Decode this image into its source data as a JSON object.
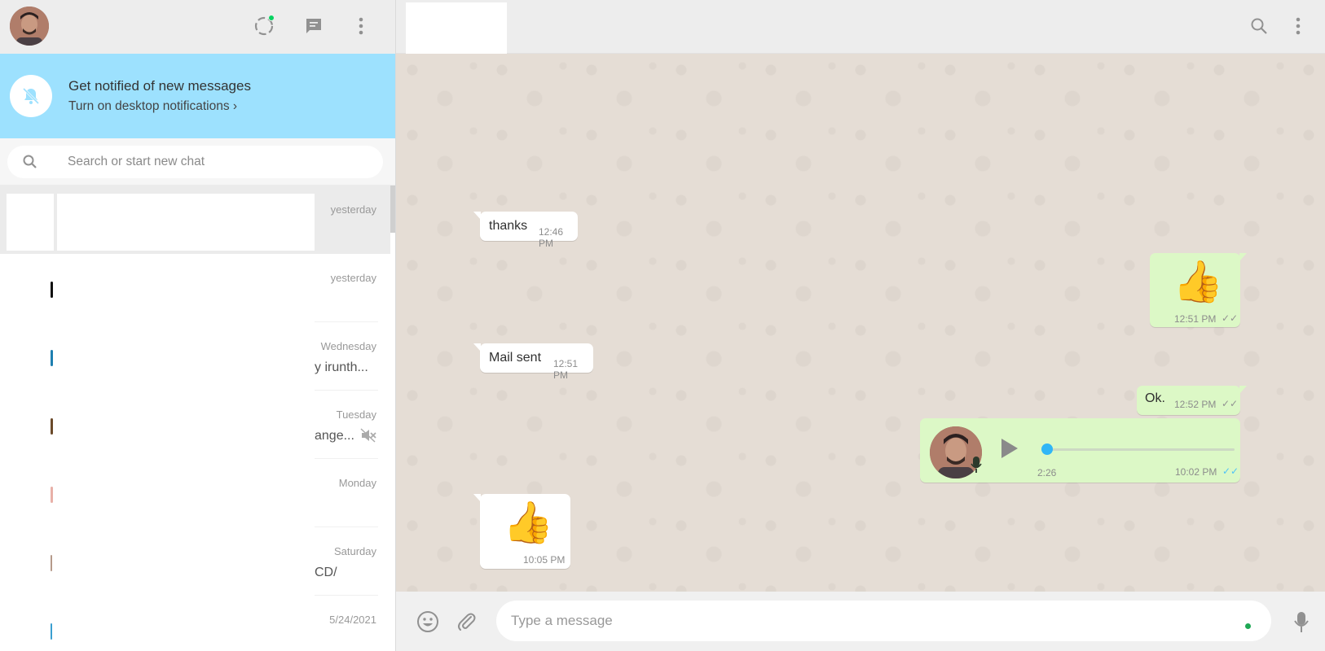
{
  "notification": {
    "title": "Get notified of new messages",
    "link": "Turn on desktop notifications ›"
  },
  "search": {
    "placeholder": "Search or start new chat"
  },
  "chats": [
    {
      "time": "yesterday",
      "preview": "",
      "active": true
    },
    {
      "time": "yesterday",
      "preview": ""
    },
    {
      "time": "Wednesday",
      "preview": "y irunth..."
    },
    {
      "time": "Tuesday",
      "preview": "ange...",
      "muted": true
    },
    {
      "time": "Monday",
      "preview": ""
    },
    {
      "time": "Saturday",
      "preview": "CD/"
    },
    {
      "time": "5/24/2021",
      "preview": ""
    }
  ],
  "messages": [
    {
      "dir": "in",
      "text": "thanks",
      "time": "12:46 PM"
    },
    {
      "dir": "out",
      "emoji": "👍",
      "time": "12:51 PM",
      "ticks": "✓✓",
      "read": false
    },
    {
      "dir": "in",
      "text": "Mail sent",
      "time": "12:51 PM"
    },
    {
      "dir": "out",
      "text": "Ok.",
      "time": "12:52 PM",
      "ticks": "✓✓",
      "read": false
    },
    {
      "dir": "out",
      "voice": true,
      "duration": "2:26",
      "time": "10:02 PM",
      "ticks": "✓✓",
      "read": true,
      "progress": 0
    },
    {
      "dir": "in",
      "emoji": "👍",
      "time": "10:05 PM"
    }
  ],
  "composer": {
    "placeholder": "Type a message"
  },
  "colors": {
    "accent": "#09d261",
    "read_ticks": "#4fc3f7",
    "notify_banner": "#9de1fe",
    "outgoing_bubble": "#dcf8c6"
  }
}
